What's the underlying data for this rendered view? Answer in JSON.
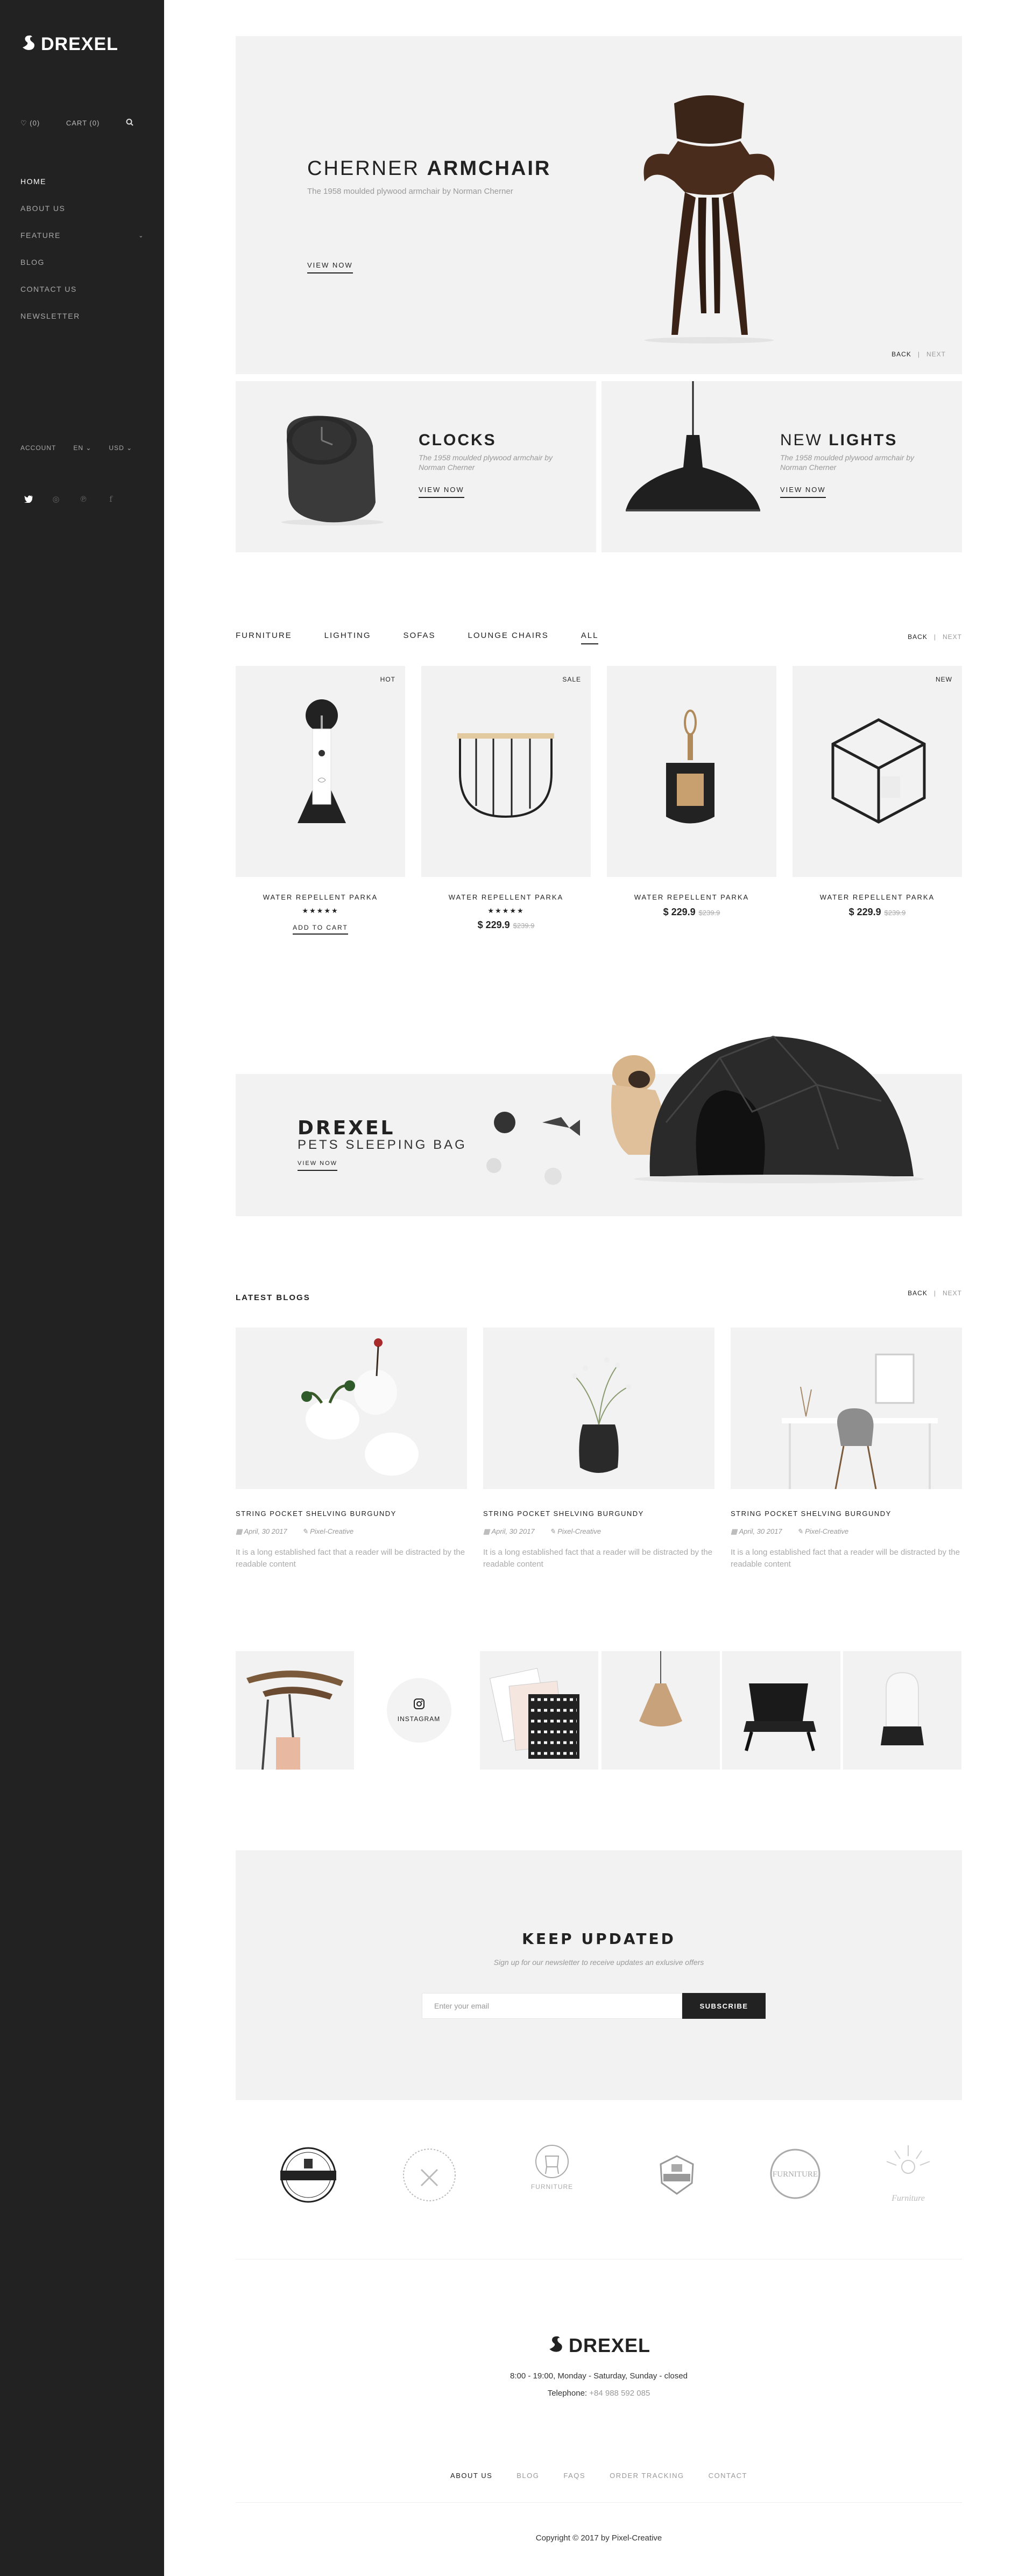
{
  "sidebar": {
    "brand": "DREXEL",
    "wishlist": "(0)",
    "cart": "CART (0)",
    "nav": [
      "HOME",
      "ABOUT US",
      "FEATURE",
      "BLOG",
      "CONTACT US",
      "NEWSLETTER"
    ],
    "account": "ACCOUNT",
    "language": "EN",
    "currency": "USD",
    "social_icons": [
      "twitter-icon",
      "dribbble-icon",
      "pinterest-icon",
      "facebook-icon"
    ]
  },
  "hero": {
    "title_light": "CHERNER",
    "title_bold": "ARMCHAIR",
    "subtitle": "The 1958 moulded plywood armchair by Norman Cherner",
    "cta": "VIEW NOW",
    "back": "BACK",
    "next": "NEXT"
  },
  "promos": [
    {
      "title_bold": "CLOCKS",
      "title_light": "",
      "subtitle": "The 1958 moulded plywood armchair by Norman Cherner",
      "cta": "VIEW NOW"
    },
    {
      "title_light": "NEW",
      "title_bold": "LIGHTS",
      "subtitle": "The 1958 moulded plywood armchair by Norman Cherner",
      "cta": "VIEW NOW"
    }
  ],
  "products": {
    "tabs": [
      "FURNITURE",
      "LIGHTING",
      "SOFAS",
      "LOUNGE CHAIRS",
      "ALL"
    ],
    "active_tab": "ALL",
    "back": "BACK",
    "next": "NEXT",
    "items": [
      {
        "badge": "HOT",
        "name": "WATER REPELLENT PARKA",
        "stars": "★★★★★",
        "price": "",
        "old_price": "",
        "cta": "ADD TO CART"
      },
      {
        "badge": "SALE",
        "name": "WATER REPELLENT PARKA",
        "stars": "★★★★★",
        "price": "$ 229.9",
        "old_price": "$239.9",
        "cta": ""
      },
      {
        "badge": "",
        "name": "WATER REPELLENT PARKA",
        "stars": "",
        "price": "$ 229.9",
        "old_price": "$239.9",
        "cta": ""
      },
      {
        "badge": "NEW",
        "name": "WATER REPELLENT PARKA",
        "stars": "",
        "price": "$ 229.9",
        "old_price": "$239.9",
        "cta": ""
      }
    ]
  },
  "banner": {
    "title": "DREXEL",
    "subtitle": "PETS SLEEPING BAG",
    "cta": "VIEW NOW"
  },
  "blogs": {
    "title": "LATEST BLOGS",
    "back": "BACK",
    "next": "NEXT",
    "posts": [
      {
        "title": "STRING POCKET SHELVING BURGUNDY",
        "date": "April, 30 2017",
        "author": "Pixel-Creative",
        "excerpt": "It is a long established fact that a reader will be distracted by the readable content"
      },
      {
        "title": "STRING POCKET SHELVING BURGUNDY",
        "date": "April, 30 2017",
        "author": "Pixel-Creative",
        "excerpt": "It is a long established fact that a reader will be distracted by the readable content"
      },
      {
        "title": "STRING POCKET SHELVING BURGUNDY",
        "date": "April, 30 2017",
        "author": "Pixel-Creative",
        "excerpt": "It is a long established fact that a reader will be distracted by the readable content"
      }
    ]
  },
  "instagram": {
    "label": "INSTAGRAM"
  },
  "newsletter": {
    "title": "KEEP UPDATED",
    "subtitle": "Sign up for our newsletter to receive updates an exlusive offers",
    "placeholder": "Enter your email",
    "button": "SUBSCRIBE"
  },
  "brands": [
    "FURNITURE",
    "FURNITURE",
    "Furniture"
  ],
  "footer": {
    "brand": "DREXEL",
    "hours": "8:00 - 19:00, Monday - Saturday, Sunday - closed",
    "phone_label": "Telephone:",
    "phone": "+84 988 592 085",
    "nav": [
      "ABOUT US",
      "BLOG",
      "FAQS",
      "ORDER TRACKING",
      "CONTACT"
    ],
    "copyright": "Copyright © 2017 by Pixel-Creative"
  }
}
